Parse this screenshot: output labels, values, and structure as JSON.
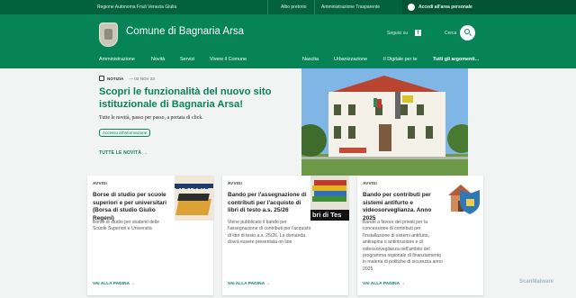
{
  "topbar": {
    "region": "Regione Autonoma Friuli Venezia Giulia",
    "links": [
      "Albo pretorio",
      "Amministrazione Trasparente"
    ],
    "login": "Accedi all'area personale"
  },
  "header": {
    "title": "Comune di Bagnaria Arsa",
    "follow": "Seguici su",
    "search": "Cerca",
    "facebook_glyph": "f"
  },
  "nav": {
    "items": [
      "Amministrazione",
      "Novità",
      "Servizi",
      "Vivere il Comune"
    ],
    "right": [
      "Nascita",
      "Urbanizzazione",
      "Il Digitale per te"
    ],
    "all": "Tutti gli argomenti..."
  },
  "hero": {
    "tag": "NOTIZIA",
    "date": "— 03 NOV 23",
    "title": "Scopri le funzionalità del nuovo sito istituzionale di Bagnaria Arsa!",
    "subtitle": "Tutte le novità, passo per passo, a portata di click.",
    "chip": "Accesso all'informazione",
    "all_news": "TUTTE LE NOVITÀ"
  },
  "cards": [
    {
      "category": "AVVISI",
      "title": "Borse di studio per scuole superiori e per universitari (Borsa di studio Giulio Regeni)",
      "desc": "Borse di studio per studenti delle Scuole Superiori e Università",
      "thumb_text": "DI STUDIO",
      "cta": "VAI ALLA PAGINA"
    },
    {
      "category": "AVVISI",
      "title": "Bando per l'assegnazione di contributi per l'acquisto di libri di testo a.s. 25/26",
      "desc": "Viene pubblicato il bando per l'assegnazione di contributi per l'acquisto di libri di testo a.s. 25/26. La domanda dovrà essere presentata on line",
      "thumb_text": "bri di Tes",
      "cta": "VAI ALLA PAGINA"
    },
    {
      "category": "AVVISI",
      "title": "Bando per contributi per sistemi antifurto e videosorveglianza. Anno 2025",
      "desc": "Bando a favore dei privati per la concessione di contributi per l'installazione di sistemi antifurto, antirapina o antintrusione e di videosorveglianza nell'ambito del programma regionale di finanziamento in materia di politiche di sicurezza anno 2025",
      "cta": "VAI ALLA PAGINA"
    }
  ],
  "watermark": "ScanMalware",
  "colors": {
    "primary": "#068457",
    "dark": "#02613f"
  }
}
